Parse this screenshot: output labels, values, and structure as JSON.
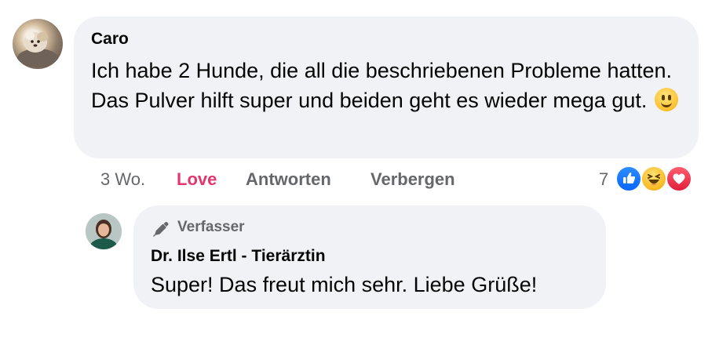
{
  "main_comment": {
    "author": "Caro",
    "text": "Ich habe 2 Hunde, die all die beschriebenen Probleme hatten. Das Pulver hilft super und beiden geht es wieder mega gut.",
    "emoji": "slightly-smiling-face",
    "actions": {
      "time": "3 Wo.",
      "love": "Love",
      "reply": "Antworten",
      "hide": "Verbergen"
    },
    "reactions": {
      "count": "7",
      "types": [
        "like",
        "haha",
        "love"
      ]
    }
  },
  "reply": {
    "badge_icon": "pen-icon",
    "badge": "Verfasser",
    "author": "Dr. Ilse Ertl - Tierärztin",
    "text": "Super! Das freut mich sehr. Liebe Grüße!"
  },
  "colors": {
    "bubble": "#f0f2f5",
    "secondary_text": "#65676b",
    "love_action": "#e3366e",
    "like_blue": "#0866ff"
  }
}
